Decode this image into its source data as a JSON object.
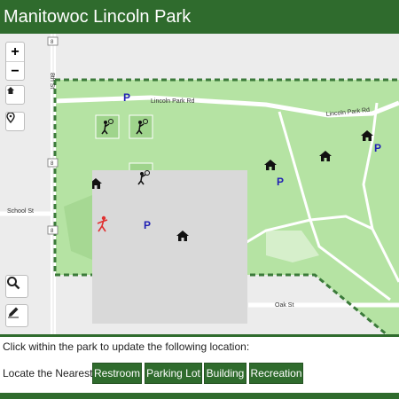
{
  "header": {
    "title": "Manitowoc Lincoln Park"
  },
  "map": {
    "controls": {
      "zoom_in": "+",
      "zoom_out": "−",
      "home_icon": "home-icon",
      "marker_icon": "map-marker-icon",
      "search_icon": "search-icon",
      "edit_icon": "pencil-icon"
    },
    "streets": {
      "lincoln_park_rd_west": "Lincoln Park Rd",
      "lincoln_park_rd_east": "Lincoln Park Rd",
      "eighth_st": "8th St",
      "school_st": "School St",
      "oak_st": "Oak St"
    },
    "route_shield": "8",
    "parking_label": "P",
    "colors": {
      "park_fill": "#b5e3a3",
      "boundary": "#3b7a3a",
      "road": "#ffffff",
      "parking": "#1f1fb3",
      "icon": "#111111",
      "highlight_icon": "#e03030"
    }
  },
  "info": {
    "instruction": "Click within the park to update the following location:",
    "locate_label": "Locate the Nearest:"
  },
  "buttons": {
    "restroom": "Restroom",
    "parking_lot": "Parking Lot",
    "building": "Building",
    "recreation": "Recreation"
  }
}
